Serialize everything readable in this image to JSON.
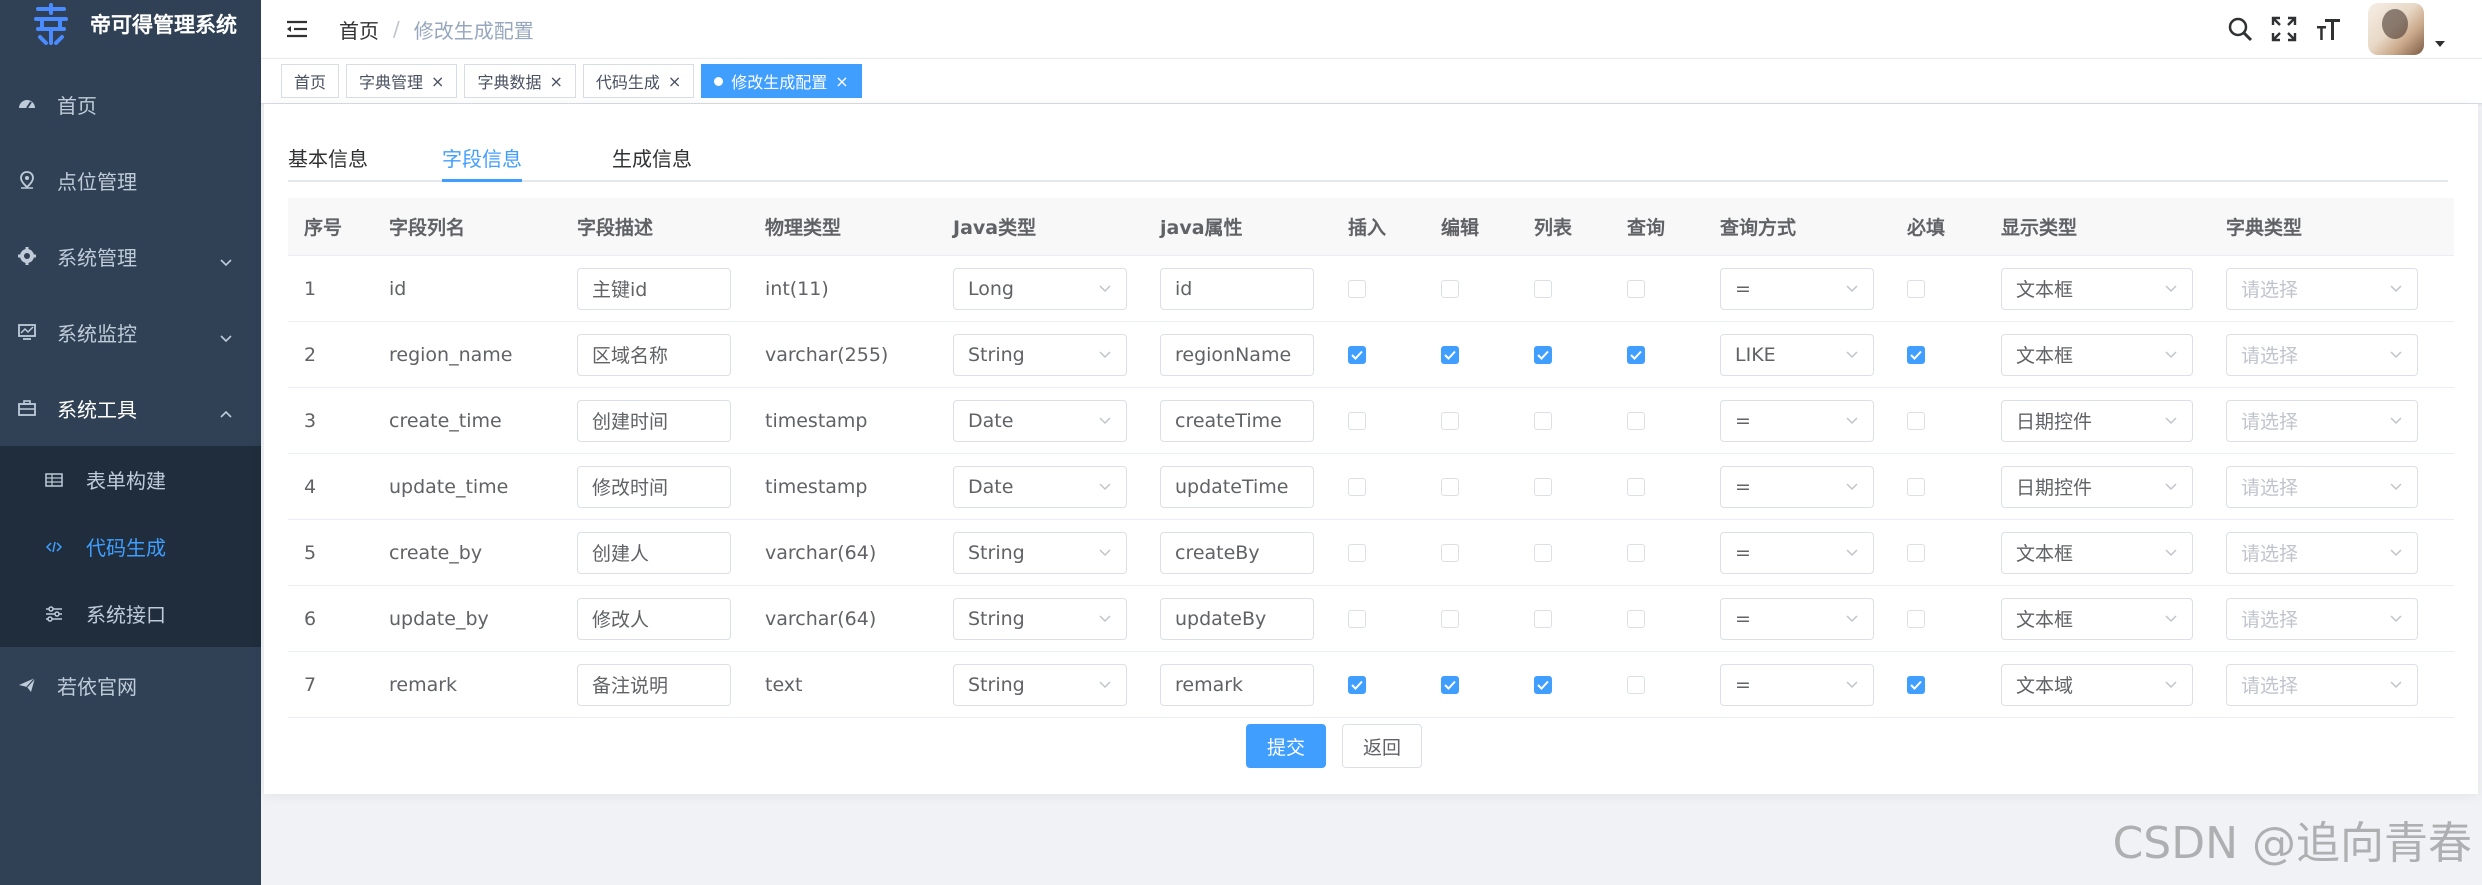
{
  "app": {
    "title": "帝可得管理系统"
  },
  "sidebar": {
    "items": [
      {
        "label": "首页",
        "icon": "dashboard-icon"
      },
      {
        "label": "点位管理",
        "icon": "location-icon"
      },
      {
        "label": "系统管理",
        "icon": "system-gear-icon"
      },
      {
        "label": "系统监控",
        "icon": "monitor-icon"
      },
      {
        "label": "系统工具",
        "icon": "toolbox-icon"
      },
      {
        "label": "若依官网",
        "icon": "paper-plane-icon"
      }
    ],
    "submenu": [
      {
        "label": "表单构建",
        "icon": "table-grid-icon"
      },
      {
        "label": "代码生成",
        "icon": "code-icon",
        "active": true
      },
      {
        "label": "系统接口",
        "icon": "sliders-icon"
      }
    ]
  },
  "breadcrumb": {
    "home": "首页",
    "separator": "/",
    "current": "修改生成配置"
  },
  "tags": [
    {
      "label": "首页",
      "closable": false
    },
    {
      "label": "字典管理",
      "closable": true
    },
    {
      "label": "字典数据",
      "closable": true
    },
    {
      "label": "代码生成",
      "closable": true
    },
    {
      "label": "修改生成配置",
      "closable": true,
      "active": true
    }
  ],
  "tabs": [
    {
      "label": "基本信息"
    },
    {
      "label": "字段信息",
      "active": true
    },
    {
      "label": "生成信息"
    }
  ],
  "table": {
    "headers": [
      "序号",
      "字段列名",
      "字段描述",
      "物理类型",
      "Java类型",
      "java属性",
      "插入",
      "编辑",
      "列表",
      "查询",
      "查询方式",
      "必填",
      "显示类型",
      "字典类型"
    ],
    "rows": [
      {
        "no": "1",
        "column": "id",
        "desc": "主键id",
        "phys": "int(11)",
        "javaType": "Long",
        "javaField": "id",
        "insert": false,
        "edit": false,
        "list": false,
        "query": false,
        "queryType": "=",
        "required": false,
        "htmlType": "文本框",
        "dictType": "请选择"
      },
      {
        "no": "2",
        "column": "region_name",
        "desc": "区域名称",
        "phys": "varchar(255)",
        "javaType": "String",
        "javaField": "regionName",
        "insert": true,
        "edit": true,
        "list": true,
        "query": true,
        "queryType": "LIKE",
        "required": true,
        "htmlType": "文本框",
        "dictType": "请选择"
      },
      {
        "no": "3",
        "column": "create_time",
        "desc": "创建时间",
        "phys": "timestamp",
        "javaType": "Date",
        "javaField": "createTime",
        "insert": false,
        "edit": false,
        "list": false,
        "query": false,
        "queryType": "=",
        "required": false,
        "htmlType": "日期控件",
        "dictType": "请选择"
      },
      {
        "no": "4",
        "column": "update_time",
        "desc": "修改时间",
        "phys": "timestamp",
        "javaType": "Date",
        "javaField": "updateTime",
        "insert": false,
        "edit": false,
        "list": false,
        "query": false,
        "queryType": "=",
        "required": false,
        "htmlType": "日期控件",
        "dictType": "请选择"
      },
      {
        "no": "5",
        "column": "create_by",
        "desc": "创建人",
        "phys": "varchar(64)",
        "javaType": "String",
        "javaField": "createBy",
        "insert": false,
        "edit": false,
        "list": false,
        "query": false,
        "queryType": "=",
        "required": false,
        "htmlType": "文本框",
        "dictType": "请选择"
      },
      {
        "no": "6",
        "column": "update_by",
        "desc": "修改人",
        "phys": "varchar(64)",
        "javaType": "String",
        "javaField": "updateBy",
        "insert": false,
        "edit": false,
        "list": false,
        "query": false,
        "queryType": "=",
        "required": false,
        "htmlType": "文本框",
        "dictType": "请选择"
      },
      {
        "no": "7",
        "column": "remark",
        "desc": "备注说明",
        "phys": "text",
        "javaType": "String",
        "javaField": "remark",
        "insert": true,
        "edit": true,
        "list": true,
        "query": false,
        "queryType": "=",
        "required": true,
        "htmlType": "文本域",
        "dictType": "请选择"
      }
    ]
  },
  "actions": {
    "submit": "提交",
    "back": "返回"
  },
  "watermark": "CSDN @追向青春",
  "colors": {
    "sidebar_bg": "#304156",
    "submenu_bg": "#1f2d3d",
    "accent": "#409eff"
  }
}
